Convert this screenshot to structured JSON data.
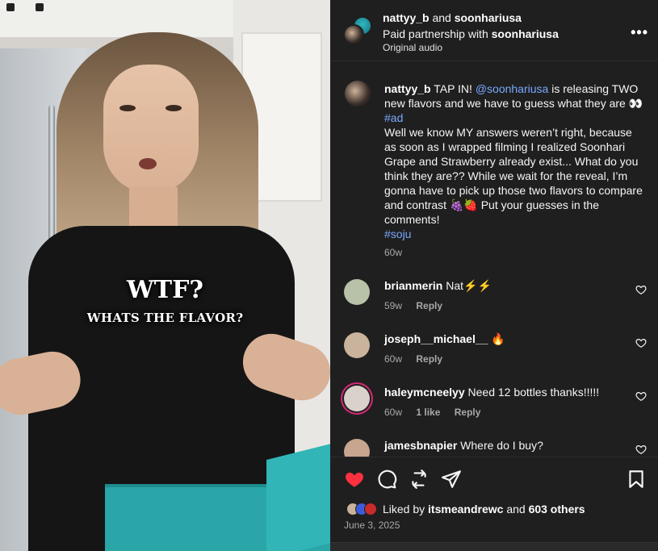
{
  "header": {
    "user1": "nattyy_b",
    "and": "and",
    "user2": "soonhariusa",
    "paid_prefix": "Paid partnership with",
    "paid_brand": "soonhariusa",
    "audio": "Original audio",
    "more_label": "•••"
  },
  "video": {
    "overlay_big": "WTF?",
    "overlay_small": "WHATS THE FLAVOR?"
  },
  "caption": {
    "username": "nattyy_b",
    "part1": " TAP IN! ",
    "mention": "@soonhariusa",
    "part2": " is releasing TWO new flavors and we have to guess what they are 👀 ",
    "hashtag1": "#ad",
    "part3": "\nWell we know MY answers weren’t right, because as soon as I wrapped filming I realized Soonhari Grape and Strawberry already exist... What do you think they are?? While we wait for the reveal, I’m gonna have to pick up those two flavors to compare and contrast 🍇🍓 Put your guesses in the comments!\n",
    "hashtag2": "#soju",
    "time": "60w"
  },
  "comments": [
    {
      "username": "brianmerin",
      "text": "Nat⚡⚡",
      "time": "59w",
      "likes": "",
      "reply": "Reply",
      "avatar_color": "#b7c2a8"
    },
    {
      "username": "joseph__michael__",
      "text": "🔥",
      "time": "60w",
      "likes": "",
      "reply": "Reply",
      "avatar_color": "#c9b39c"
    },
    {
      "username": "haleymcneelyy",
      "text": "Need 12 bottles thanks!!!!!",
      "time": "60w",
      "likes": "1 like",
      "reply": "Reply",
      "avatar_color": "#d9d2cb"
    },
    {
      "username": "jamesbnapier",
      "text": "Where do I buy?",
      "time": "",
      "likes": "",
      "reply": "",
      "avatar_color": "#c7a58f"
    }
  ],
  "likes": {
    "prefix": "Liked by",
    "user": "itsmeandrewc",
    "and": "and",
    "count": "603 others"
  },
  "date": "June 3, 2025",
  "colors": {
    "heart": "#ff3040",
    "link": "#7aa8ff",
    "panel_bg": "#1f1f1f"
  },
  "icons": [
    "heart-icon",
    "comment-icon",
    "repost-icon",
    "share-icon",
    "bookmark-icon",
    "more-icon"
  ]
}
